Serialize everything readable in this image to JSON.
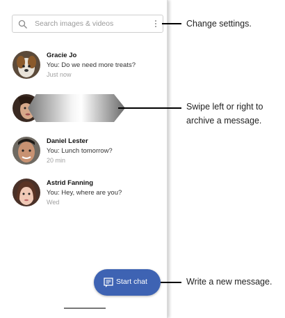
{
  "search": {
    "placeholder": "Search images & videos"
  },
  "conversations": [
    {
      "name": "Gracie Jo",
      "message": "You: Do we need more treats?",
      "time": "Just now"
    },
    {
      "name": "Daniel Lester",
      "message": "You: Lunch tomorrow?",
      "time": "20 min"
    },
    {
      "name": "Astrid Fanning",
      "message": "You: Hey, where are you?",
      "time": "Wed"
    }
  ],
  "fab": {
    "label": "Start chat"
  },
  "callouts": {
    "settings": "Change settings.",
    "swipe_line1": "Swipe left or right to",
    "swipe_line2": "archive a message.",
    "new_message": "Write a new message."
  },
  "colors": {
    "fab": "#3e63b3",
    "callout_line": "#000000"
  },
  "icons": [
    "search-icon",
    "more-vert-icon",
    "message-icon"
  ]
}
